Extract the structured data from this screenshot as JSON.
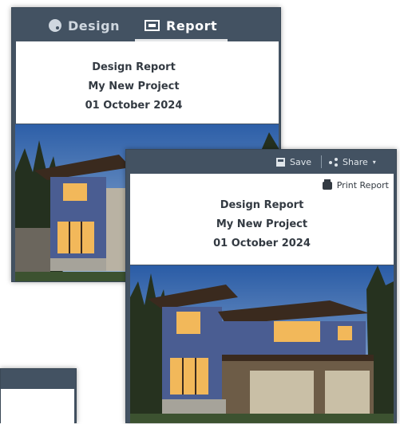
{
  "back_window": {
    "tabs": [
      {
        "label": "Design",
        "icon": "palette-icon",
        "active": false
      },
      {
        "label": "Report",
        "icon": "report-icon",
        "active": true
      }
    ],
    "header": {
      "title": "Design Report",
      "project": "My New Project",
      "date": "01 October 2024"
    }
  },
  "front_window": {
    "toolbar": {
      "save_label": "Save",
      "share_label": "Share"
    },
    "print_label": "Print Report",
    "header": {
      "title": "Design Report",
      "project": "My New Project",
      "date": "01 October 2024"
    }
  },
  "colors": {
    "frame": "#435262",
    "text_dark": "#333a42"
  }
}
